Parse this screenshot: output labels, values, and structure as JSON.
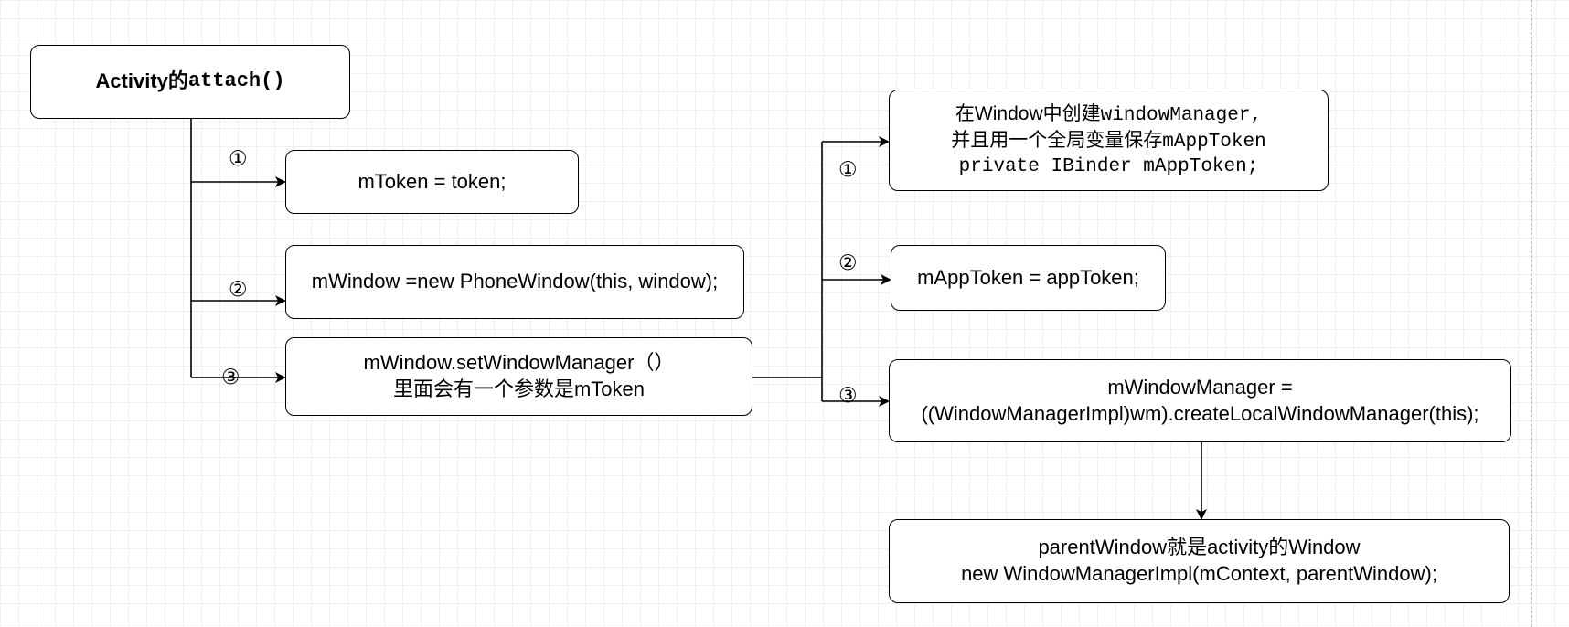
{
  "title_box": {
    "plain": "Activity的",
    "code": "attach()"
  },
  "left_branch": {
    "steps": [
      "①",
      "②",
      "③"
    ],
    "box1": "mToken = token;",
    "box2": "mWindow =new PhoneWindow(this, window);",
    "box3_line1": "mWindow.setWindowManager（）",
    "box3_line2": "里面会有一个参数是mToken"
  },
  "right_branch": {
    "steps": [
      "①",
      "②",
      "③"
    ],
    "box1_line1_plain": "在Window中创建",
    "box1_line1_code": "windowManager,",
    "box1_line2_plain": "并且用一个全局变量保存",
    "box1_line2_code": "mAppToken",
    "box1_line3_code": "private IBinder mAppToken;",
    "box2": "mAppToken = appToken;",
    "box3_line1": "mWindowManager =",
    "box3_line2": "((WindowManagerImpl)wm).createLocalWindowManager(this);",
    "box4_line1": "parentWindow就是activity的Window",
    "box4_line2": "new WindowManagerImpl(mContext, parentWindow);"
  },
  "colors": {
    "stroke": "#000000",
    "grid": "#efefef",
    "background": "#ffffff"
  }
}
